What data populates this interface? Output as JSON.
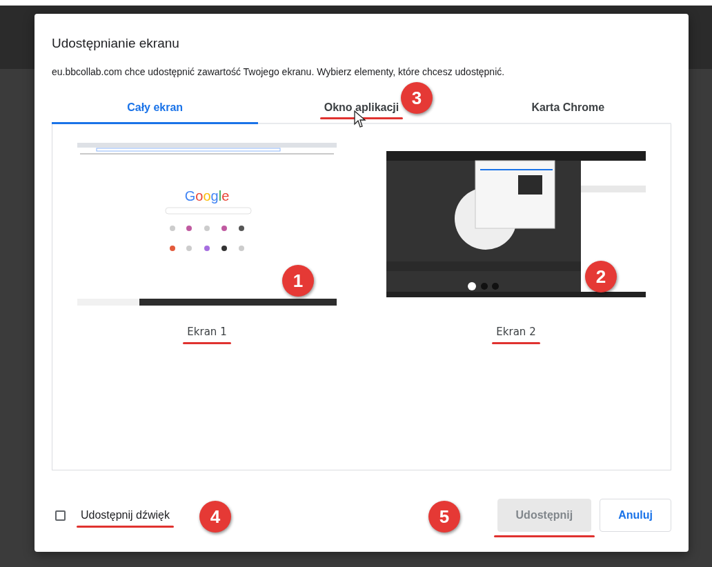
{
  "dialog": {
    "title": "Udostępnianie ekranu",
    "message": "eu.bbcollab.com chce udostępnić zawartość Twojego ekranu. Wybierz elementy, które chcesz udostępnić."
  },
  "tabs": [
    {
      "label": "Cały ekran",
      "selected": true,
      "underlined": false
    },
    {
      "label": "Okno aplikacji",
      "selected": false,
      "underlined": true
    },
    {
      "label": "Karta Chrome",
      "selected": false,
      "underlined": false
    }
  ],
  "screens": [
    {
      "label": "Ekran 1",
      "kind": "light",
      "logo": "Google",
      "underlined": true
    },
    {
      "label": "Ekran 2",
      "kind": "dark",
      "underlined": true
    }
  ],
  "sound": {
    "label": "Udostępnij dźwięk",
    "checked": false,
    "underlined": true
  },
  "buttons": [
    {
      "label": "Udostępnij",
      "disabled": true,
      "underlined": true
    },
    {
      "label": "Anuluj",
      "disabled": false,
      "underlined": false
    }
  ],
  "annotations": [
    {
      "number": "1"
    },
    {
      "number": "2"
    },
    {
      "number": "3"
    },
    {
      "number": "4"
    },
    {
      "number": "5"
    }
  ]
}
